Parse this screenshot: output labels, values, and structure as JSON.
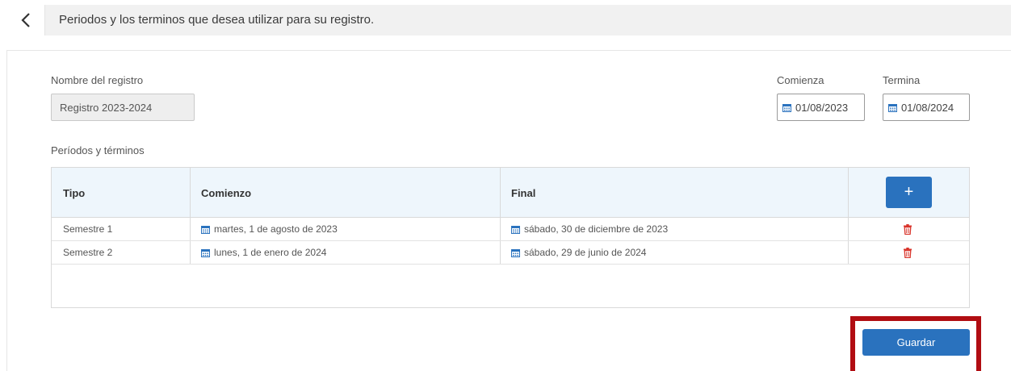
{
  "header": {
    "title": "Periodos y los terminos que desea utilizar para su registro."
  },
  "form": {
    "name_label": "Nombre del registro",
    "name_value": "Registro 2023-2024",
    "start_label": "Comienza",
    "start_value": "01/08/2023",
    "end_label": "Termina",
    "end_value": "01/08/2024"
  },
  "periods": {
    "section_label": "Períodos y términos",
    "columns": {
      "type": "Tipo",
      "start": "Comienzo",
      "end": "Final",
      "add": "+"
    },
    "rows": [
      {
        "type": "Semestre 1",
        "start": "martes, 1 de agosto de 2023",
        "end": "sábado, 30 de diciembre de 2023"
      },
      {
        "type": "Semestre 2",
        "start": "lunes, 1 de enero de 2024",
        "end": "sábado, 29 de junio de 2024"
      }
    ]
  },
  "actions": {
    "save_label": "Guardar"
  },
  "colors": {
    "primary": "#2a72be",
    "calendar_icon": "#2a72be",
    "delete_icon": "#d9342b",
    "highlight": "#b10d12",
    "header_bg": "#eef6fc"
  },
  "icons": {
    "back": "chevron-left-icon",
    "calendar": "calendar-icon",
    "delete": "trash-icon"
  }
}
